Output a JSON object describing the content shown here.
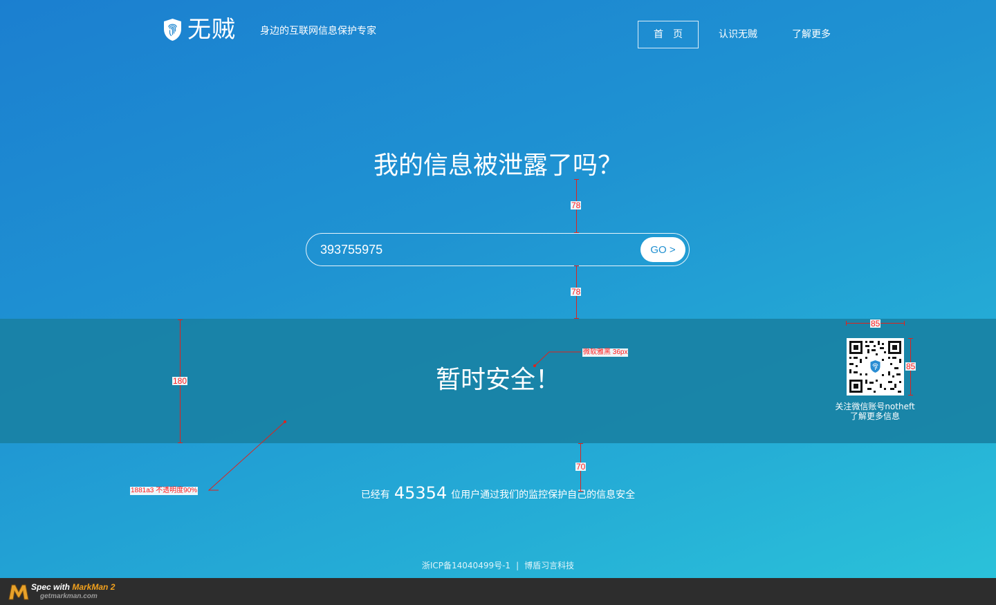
{
  "header": {
    "logo_text": "无贼",
    "tagline": "身边的互联网信息保护专家",
    "nav": [
      {
        "label": "首页",
        "active": true
      },
      {
        "label": "认识无贼",
        "active": false
      },
      {
        "label": "了解更多",
        "active": false
      }
    ]
  },
  "hero": {
    "title": "我的信息被泄露了吗？",
    "search_value": "393755975",
    "go_label": "GO >"
  },
  "result": {
    "status_text": "暂时安全！",
    "qr_caption_line1": "关注微信账号notheft",
    "qr_caption_line2": "了解更多信息"
  },
  "stats": {
    "prefix": "已经有",
    "count": "45354",
    "suffix": "位用户通过我们的监控保护自己的信息安全"
  },
  "footer": {
    "icp": "浙ICP备14040499号-1",
    "separator": "|",
    "company": "博盾习言科技"
  },
  "annotations": {
    "gap_title_search": "78",
    "gap_search_band": "78",
    "band_height": "180",
    "band_to_stats": "70",
    "qr_width": "85",
    "qr_height": "85",
    "font_spec": "微软雅黑 36px",
    "band_color_spec": "1881a3 不透明度90%"
  },
  "markman": {
    "prefix": "Spec with ",
    "brand": "MarkMan 2",
    "url": "getmarkman.com"
  },
  "colors": {
    "bg_top": "#1b7fd0",
    "bg_bottom": "#2bc4da",
    "band": "#1881a3",
    "annotation": "#e0221c"
  }
}
